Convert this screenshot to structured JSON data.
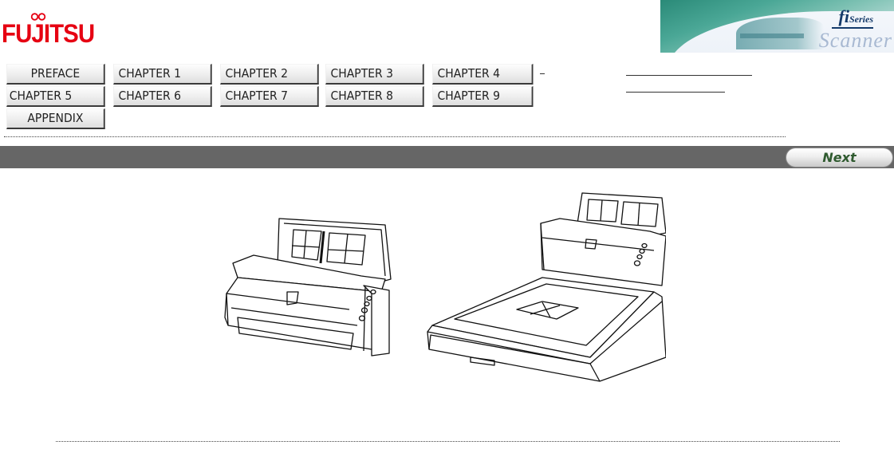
{
  "brand": {
    "logo_text": "FUJITSU",
    "logo_color": "#e60012"
  },
  "banner": {
    "series_name": "fi",
    "series_suffix": "Series",
    "tagline": "Scanner"
  },
  "nav": {
    "buttons": [
      {
        "label": "PREFACE"
      },
      {
        "label": "CHAPTER 1"
      },
      {
        "label": "CHAPTER 2"
      },
      {
        "label": "CHAPTER 3"
      },
      {
        "label": "CHAPTER 4"
      },
      {
        "label": "CHAPTER 5"
      },
      {
        "label": "CHAPTER 6"
      },
      {
        "label": "CHAPTER 7"
      },
      {
        "label": "CHAPTER 8"
      },
      {
        "label": "CHAPTER 9"
      },
      {
        "label": "APPENDIX"
      }
    ]
  },
  "toolbar": {
    "next_label": "Next",
    "bar_color": "#666666",
    "next_text_color": "#2f5a2f"
  },
  "illustrations": [
    {
      "name": "sheet-fed scanner"
    },
    {
      "name": "flatbed scanner with document feeder"
    }
  ]
}
